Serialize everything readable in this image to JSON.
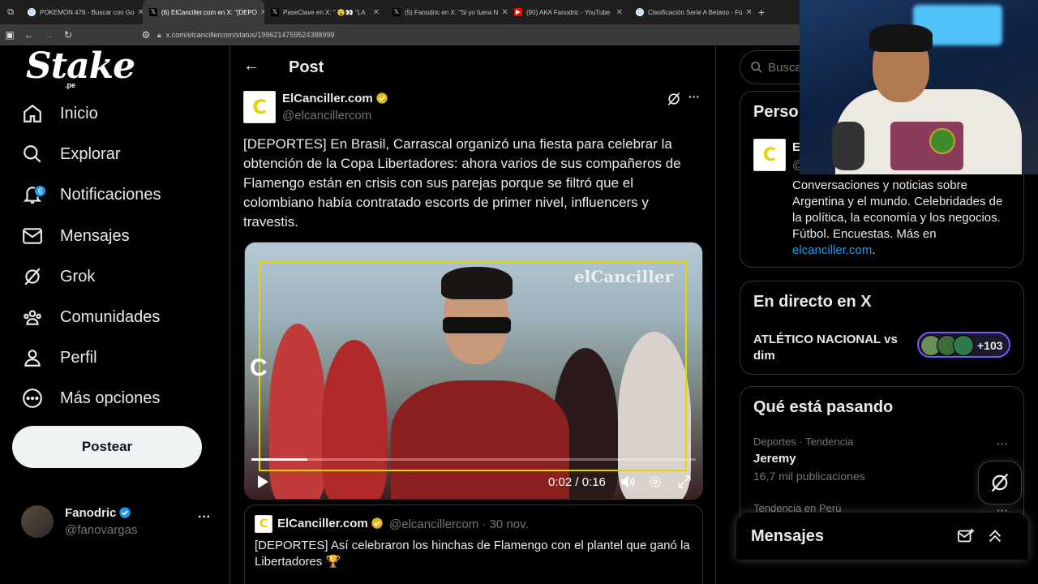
{
  "browser": {
    "tabs": [
      {
        "label": "POKEMON 476 - Buscar con Go",
        "active": false,
        "icon": "google-icon"
      },
      {
        "label": "(6) ElCanciller.com en X: \"[DEPO",
        "active": true,
        "icon": "x-icon"
      },
      {
        "label": "PaseClave en X: \" 😮👀 \"LA",
        "active": false,
        "icon": "x-icon"
      },
      {
        "label": "(5) Fanodric en X: \"Si yo fuera N",
        "active": false,
        "icon": "x-icon"
      },
      {
        "label": "(90) AKA Fanodric - YouTube",
        "active": false,
        "icon": "youtube-icon"
      },
      {
        "label": "Clasificación Serie A Betano - Fú",
        "active": false,
        "icon": "google-icon"
      }
    ],
    "url": "x.com/elcancillercom/status/1996214759524388999"
  },
  "sidebar": {
    "logo": "Stake",
    "logo_sub": ".pe",
    "items": [
      {
        "label": "Inicio",
        "icon": "home-icon"
      },
      {
        "label": "Explorar",
        "icon": "search-icon"
      },
      {
        "label": "Notificaciones",
        "icon": "bell-icon",
        "badge": "6"
      },
      {
        "label": "Mensajes",
        "icon": "mail-icon"
      },
      {
        "label": "Grok",
        "icon": "grok-icon"
      },
      {
        "label": "Comunidades",
        "icon": "communities-icon"
      },
      {
        "label": "Perfil",
        "icon": "person-icon"
      },
      {
        "label": "Más opciones",
        "icon": "more-circle-icon"
      }
    ],
    "post_button": "Postear",
    "account": {
      "name": "Fanodric",
      "handle": "@fanovargas"
    }
  },
  "post": {
    "header_title": "Post",
    "author_name": "ElCanciller.com",
    "author_handle": "@elcancillercom",
    "avatar_letter": "C",
    "text": "[DEPORTES] En Brasil, Carrascal organizó una fiesta para celebrar la obtención de la Copa Libertadores: ahora varios de sus compañeros de Flamengo están en crisis con sus parejas porque se filtró que el colombiano había contratado escorts de primer nivel, influencers y travestis.",
    "video": {
      "watermark": "elCanciller",
      "corner_mark": "C",
      "time": "0:02 / 0:16",
      "progress": 0.125
    },
    "quote": {
      "author_name": "ElCanciller.com",
      "meta": "@elcancillercom · 30 nov.",
      "text": "[DEPORTES] Así celebraron los hinchas de Flamengo con el plantel que ganó la Libertadores 🏆"
    }
  },
  "right": {
    "search_placeholder": "Busca",
    "relevant": {
      "title": "Perso",
      "name": "E",
      "handle": "@",
      "bio": "Conversaciones y noticias sobre Argentina y el mundo. Celebridades de la política, la economía y los negocios. Fútbol. Encuestas. Más en",
      "link": "elcanciller.com",
      "tail": "."
    },
    "live": {
      "title": "En directo en X",
      "event": "ATLÉTICO NACIONAL vs dim",
      "count": "+103"
    },
    "trends": {
      "title": "Qué está pasando",
      "items": [
        {
          "meta": "Deportes · Tendencia",
          "name": "Jeremy",
          "posts": "16,7 mil publicaciones"
        },
        {
          "meta": "Tendencia en Perú",
          "name": "",
          "posts": ""
        }
      ]
    },
    "messages_drawer": "Mensajes"
  },
  "colors": {
    "accent": "#1d9bf0",
    "verified_gold": "#e2b719",
    "canciller_yellow": "#e1d400",
    "live_ring": "#7856ff"
  }
}
